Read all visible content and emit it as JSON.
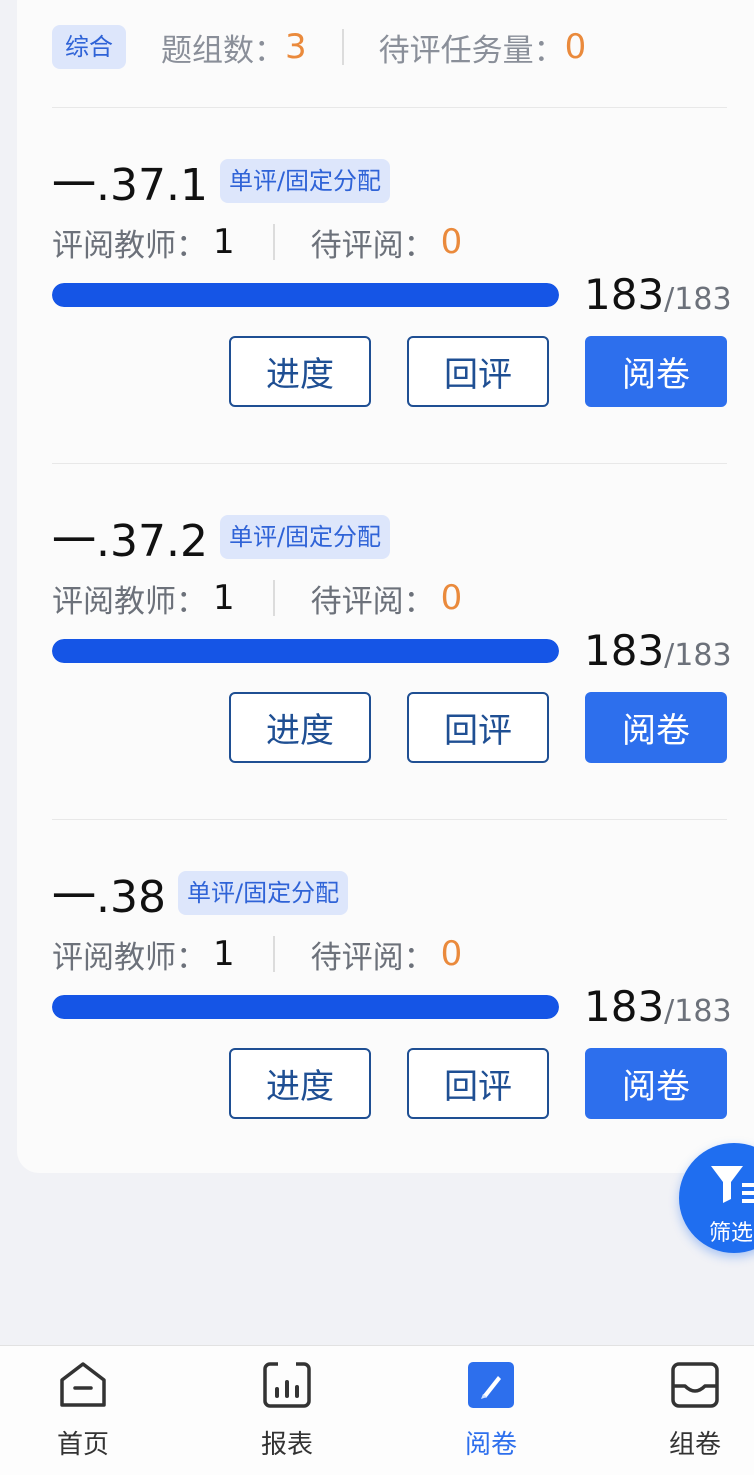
{
  "summary": {
    "tag": "综合",
    "group_count_label": "题组数：",
    "group_count": "3",
    "pending_tasks_label": "待评任务量：",
    "pending_tasks": "0"
  },
  "items": [
    {
      "title": "一.37.1",
      "mode": "单评/固定分配",
      "teacher_label": "评阅教师：",
      "teacher_count": "1",
      "pending_label": "待评阅：",
      "pending": "0",
      "done": "183",
      "total": "/183",
      "progress": 1.0,
      "buttons": {
        "progress": "进度",
        "review": "回评",
        "read": "阅卷"
      }
    },
    {
      "title": "一.37.2",
      "mode": "单评/固定分配",
      "teacher_label": "评阅教师：",
      "teacher_count": "1",
      "pending_label": "待评阅：",
      "pending": "0",
      "done": "183",
      "total": "/183",
      "progress": 1.0,
      "buttons": {
        "progress": "进度",
        "review": "回评",
        "read": "阅卷"
      }
    },
    {
      "title": "一.38",
      "mode": "单评/固定分配",
      "teacher_label": "评阅教师：",
      "teacher_count": "1",
      "pending_label": "待评阅：",
      "pending": "0",
      "done": "183",
      "total": "/183",
      "progress": 1.0,
      "buttons": {
        "progress": "进度",
        "review": "回评",
        "read": "阅卷"
      }
    }
  ],
  "filter_button": {
    "label": "筛选",
    "icon": "filter-icon"
  },
  "tabbar": [
    {
      "label": "首页",
      "icon": "home-icon",
      "active": false
    },
    {
      "label": "报表",
      "icon": "report-icon",
      "active": false
    },
    {
      "label": "阅卷",
      "icon": "marking-icon",
      "active": true
    },
    {
      "label": "组卷",
      "icon": "compose-paper-icon",
      "active": false
    }
  ],
  "colors": {
    "accent": "#2d6fed",
    "progress_fill": "#1555e6",
    "highlight_number": "#ea8a3c",
    "tag_bg": "#dde6fb"
  }
}
